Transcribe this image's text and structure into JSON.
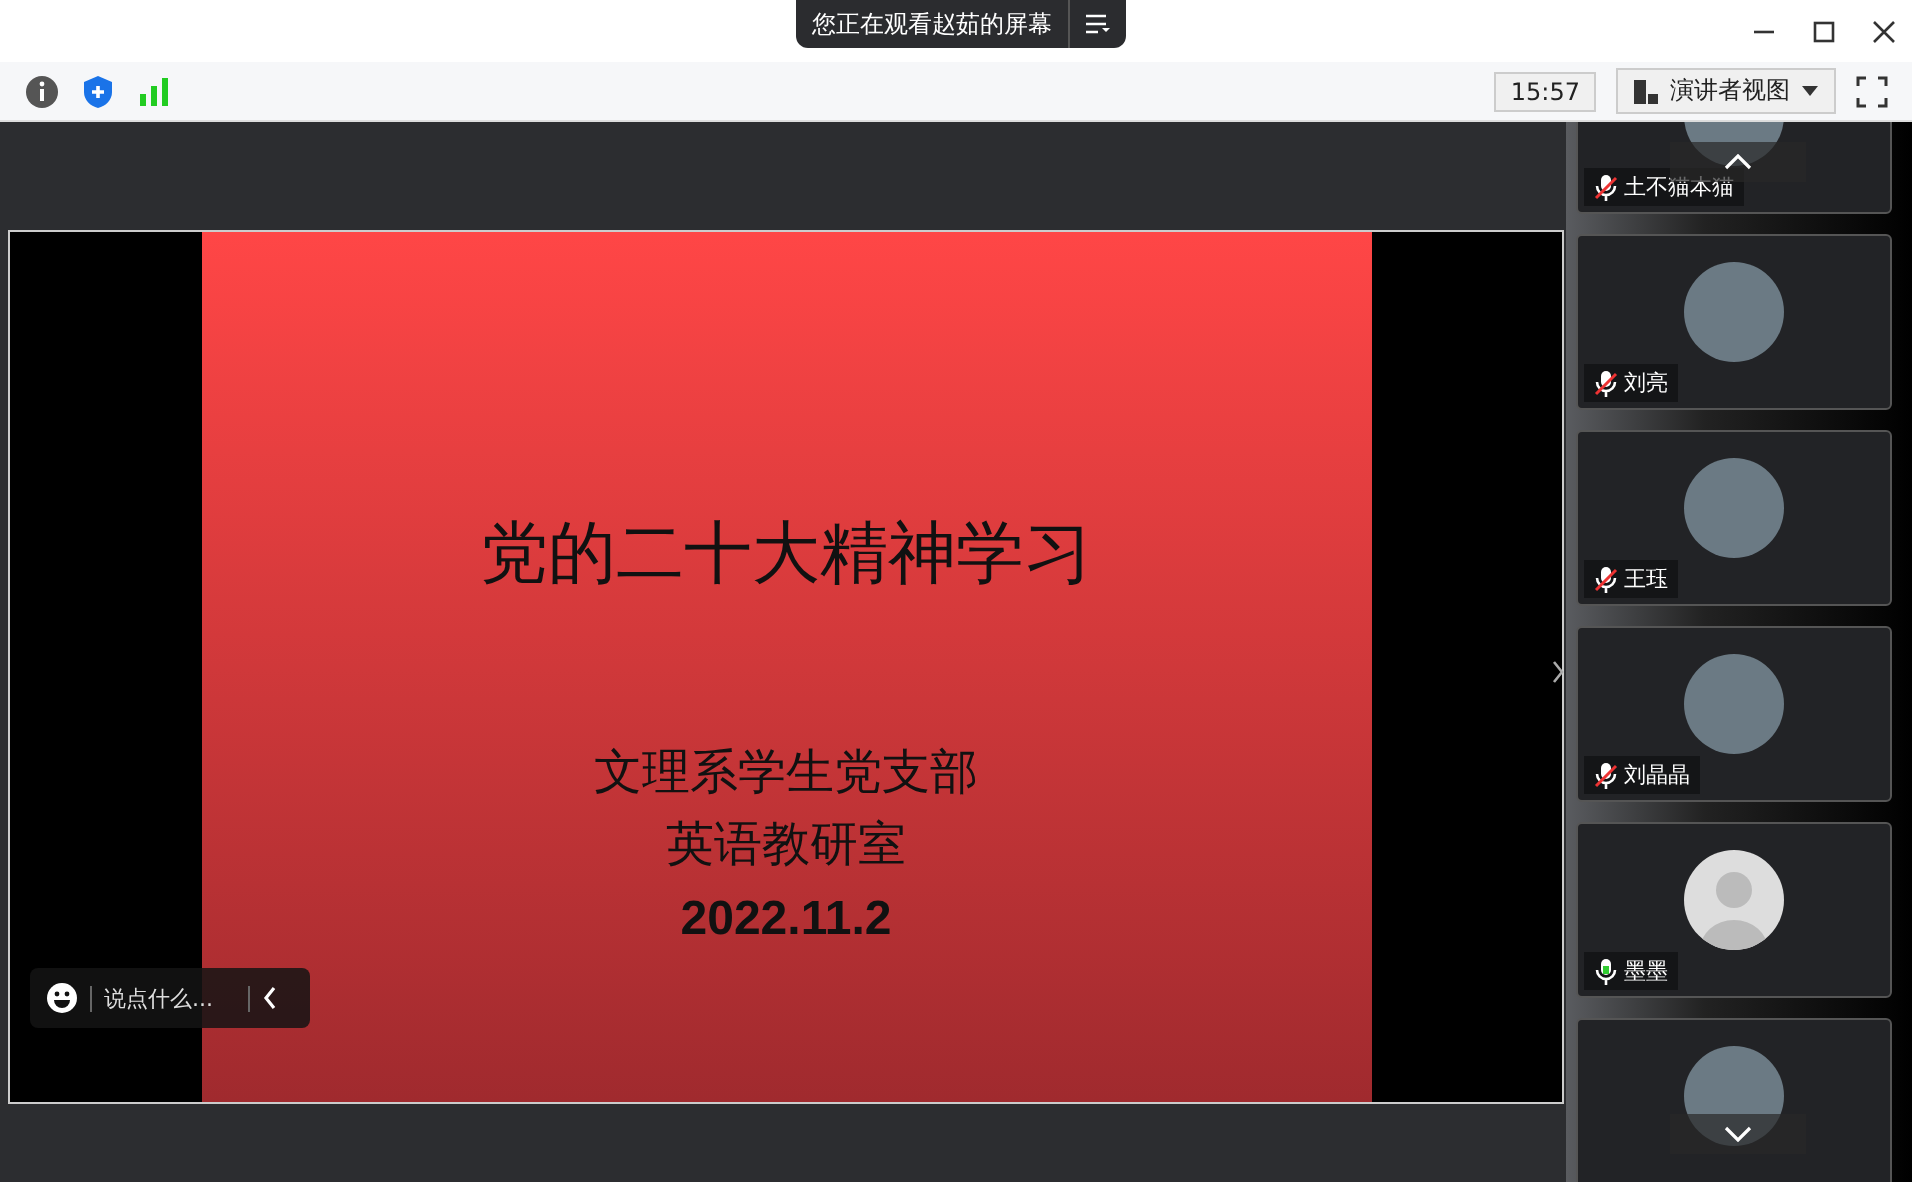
{
  "banner": {
    "text": "您正在观看赵茹的屏幕"
  },
  "toolbar": {
    "time": "15:57",
    "view_menu": "演讲者视图"
  },
  "slide": {
    "title": "党的二十大精神学习",
    "lines": [
      "文理系学生党支部",
      "英语教研室"
    ],
    "date": "2022.11.2"
  },
  "chat": {
    "placeholder": "说点什么..."
  },
  "participants": [
    {
      "name": "土不猫本猫",
      "muted": true,
      "default_avatar": false
    },
    {
      "name": "刘亮",
      "muted": true,
      "default_avatar": false
    },
    {
      "name": "王珏",
      "muted": true,
      "default_avatar": false
    },
    {
      "name": "刘晶晶",
      "muted": true,
      "default_avatar": false
    },
    {
      "name": "墨墨",
      "muted": false,
      "default_avatar": true
    }
  ]
}
